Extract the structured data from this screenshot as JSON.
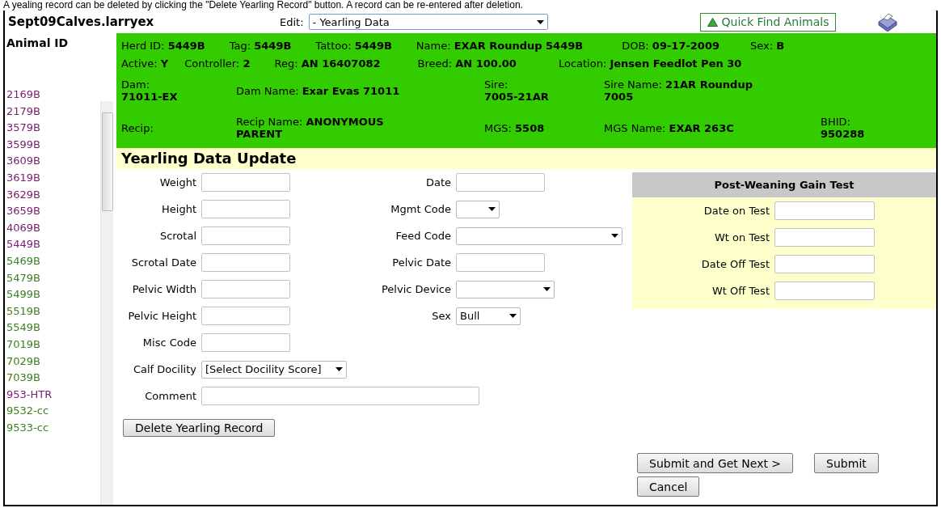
{
  "caption": "A yealing record can be deleted  by clicking the \"Delete Yearling Record\" button. A record can be re-entered after deletion.",
  "file_title": "Sept09Calves.larryex",
  "edit": {
    "label": "Edit:",
    "value": "- Yearling Data"
  },
  "quick_find": {
    "label": "Quick Find Animals"
  },
  "sidebar": {
    "header": "Animal ID",
    "items": [
      {
        "id": "2169B",
        "color": "#7b2170"
      },
      {
        "id": "2179B",
        "color": "#7b2170"
      },
      {
        "id": "3579B",
        "color": "#7b2170"
      },
      {
        "id": "3599B",
        "color": "#7b2170"
      },
      {
        "id": "3609B",
        "color": "#7b2170"
      },
      {
        "id": "3619B",
        "color": "#7b2170"
      },
      {
        "id": "3629B",
        "color": "#7b2170"
      },
      {
        "id": "3659B",
        "color": "#7b2170"
      },
      {
        "id": "4069B",
        "color": "#7b2170"
      },
      {
        "id": "5449B",
        "color": "#7b2170"
      },
      {
        "id": "5469B",
        "color": "#3f7f1f"
      },
      {
        "id": "5479B",
        "color": "#3f7f1f"
      },
      {
        "id": "5499B",
        "color": "#3f7f1f"
      },
      {
        "id": "5519B",
        "color": "#3f7f1f"
      },
      {
        "id": "5549B",
        "color": "#3f7f1f"
      },
      {
        "id": "7019B",
        "color": "#3f7f1f"
      },
      {
        "id": "7029B",
        "color": "#3f7f1f"
      },
      {
        "id": "7039B",
        "color": "#3f7f1f"
      },
      {
        "id": "953-HTR",
        "color": "#7b2170"
      },
      {
        "id": "9532-cc",
        "color": "#3f7f1f"
      },
      {
        "id": "9533-cc",
        "color": "#3f7f1f"
      }
    ]
  },
  "animal_info": {
    "top_rows": [
      {
        "fields": [
          {
            "label": "Herd ID:",
            "value": "5449B"
          },
          {
            "label": "Tag:",
            "value": "5449B"
          },
          {
            "label": "Tattoo:",
            "value": "5449B"
          },
          {
            "label": "Name:",
            "value": "EXAR Roundup 5449B"
          },
          {
            "label": "DOB:",
            "value": "09-17-2009"
          },
          {
            "label": "Sex:",
            "value": "B"
          }
        ]
      },
      {
        "fields": [
          {
            "label": "Active:",
            "value": "Y"
          },
          {
            "label": "Controller:",
            "value": "2"
          },
          {
            "label": "Reg:",
            "value": "AN 16407082"
          },
          {
            "label": "Breed:",
            "value": "AN 100.00"
          },
          {
            "label": "Location:",
            "value": "Jensen Feedlot Pen 30"
          }
        ]
      }
    ],
    "grid_rows": [
      {
        "fields": [
          {
            "label": "Dam:",
            "value": "71011-EX",
            "kind": "stacked"
          },
          {
            "label": "Dam Name:",
            "value": "Exar Evas 71011",
            "kind": "inline"
          },
          {
            "label": "Sire:",
            "value": "7005-21AR",
            "kind": "stacked"
          },
          {
            "label": "Sire Name:",
            "value": "21AR Roundup 7005",
            "kind": "inline"
          },
          {
            "kind": "empty"
          }
        ]
      },
      {
        "fields": [
          {
            "label": "Recip:",
            "kind": "inline"
          },
          {
            "label": "Recip Name:",
            "value": "ANONYMOUS PARENT",
            "kind": "inline"
          },
          {
            "label": "MGS:",
            "value": "5508",
            "kind": "inline"
          },
          {
            "label": "MGS Name:",
            "value": "EXAR 263C",
            "kind": "inline"
          },
          {
            "label": "BHID:",
            "value": "950288",
            "kind": "stacked"
          }
        ]
      }
    ]
  },
  "form": {
    "title": "Yearling Data Update",
    "rows": [
      {
        "left": {
          "label": "Weight",
          "kind": "input"
        },
        "right": {
          "label": "Date",
          "kind": "input"
        }
      },
      {
        "left": {
          "label": "Height",
          "kind": "input"
        },
        "right": {
          "label": "Mgmt Code",
          "kind": "select-small"
        }
      },
      {
        "left": {
          "label": "Scrotal",
          "kind": "input"
        },
        "right": {
          "label": "Feed Code",
          "kind": "select-wide"
        }
      },
      {
        "left": {
          "label": "Scrotal Date",
          "kind": "input"
        },
        "right": {
          "label": "Pelvic Date",
          "kind": "input"
        }
      },
      {
        "left": {
          "label": "Pelvic Width",
          "kind": "input"
        },
        "right": {
          "label": "Pelvic Device",
          "kind": "select"
        }
      },
      {
        "left": {
          "label": "Pelvic Height",
          "kind": "input"
        },
        "right": {
          "label": "Sex",
          "kind": "select-small",
          "value": "Bull"
        }
      },
      {
        "left": {
          "label": "Misc Code",
          "kind": "input"
        }
      },
      {
        "left": {
          "label": "Calf Docility",
          "kind": "select",
          "value": "[Select Docility Score]"
        }
      },
      {
        "left": {
          "label": "Comment",
          "kind": "input-wide"
        }
      }
    ],
    "delete_button": "Delete Yearling Record"
  },
  "gain_test": {
    "title": "Post-Weaning Gain Test",
    "fields": [
      {
        "label": "Date on Test"
      },
      {
        "label": "Wt on Test"
      },
      {
        "label": "Date Off Test"
      },
      {
        "label": "Wt Off Test"
      }
    ]
  },
  "buttons": {
    "submit_next": "Submit and Get Next >",
    "submit": "Submit",
    "cancel": "Cancel"
  }
}
